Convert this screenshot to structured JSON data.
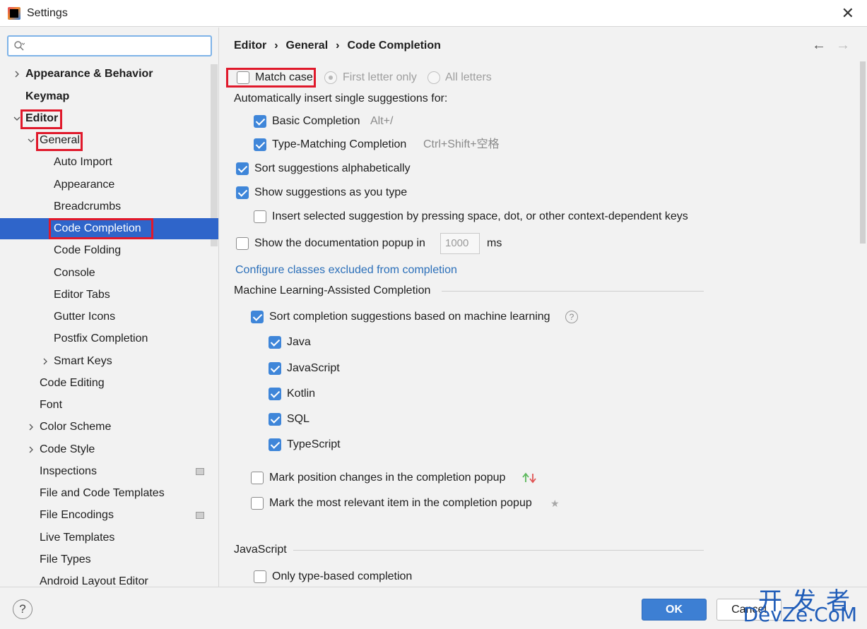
{
  "window": {
    "title": "Settings"
  },
  "sidebar": {
    "search_placeholder": "",
    "items": [
      {
        "label": "Appearance & Behavior"
      },
      {
        "label": "Keymap"
      },
      {
        "label": "Editor"
      },
      {
        "label": "General"
      },
      {
        "label": "Auto Import"
      },
      {
        "label": "Appearance"
      },
      {
        "label": "Breadcrumbs"
      },
      {
        "label": "Code Completion"
      },
      {
        "label": "Code Folding"
      },
      {
        "label": "Console"
      },
      {
        "label": "Editor Tabs"
      },
      {
        "label": "Gutter Icons"
      },
      {
        "label": "Postfix Completion"
      },
      {
        "label": "Smart Keys"
      },
      {
        "label": "Code Editing"
      },
      {
        "label": "Font"
      },
      {
        "label": "Color Scheme"
      },
      {
        "label": "Code Style"
      },
      {
        "label": "Inspections"
      },
      {
        "label": "File and Code Templates"
      },
      {
        "label": "File Encodings"
      },
      {
        "label": "Live Templates"
      },
      {
        "label": "File Types"
      },
      {
        "label": "Android Layout Editor"
      }
    ]
  },
  "breadcrumb": {
    "a": "Editor",
    "b": "General",
    "c": "Code Completion"
  },
  "content": {
    "match_case": "Match case:",
    "first_letter": "First letter only",
    "all_letters": "All letters",
    "auto_insert": "Automatically insert single suggestions for:",
    "basic": "Basic Completion",
    "basic_shortcut": "Alt+/",
    "type_matching": "Type-Matching Completion",
    "type_shortcut": "Ctrl+Shift+空格",
    "sort_alpha": "Sort suggestions alphabetically",
    "show_as_type": "Show suggestions as you type",
    "insert_selected": "Insert selected suggestion by pressing space, dot, or other context-dependent keys",
    "show_doc": "Show the documentation popup in",
    "doc_ms_value": "1000",
    "ms": "ms",
    "configure_link": "Configure classes excluded from completion",
    "ml_section": "Machine Learning-Assisted Completion",
    "ml_sort": "Sort completion suggestions based on machine learning",
    "ml_help": "?",
    "langs": [
      "Java",
      "JavaScript",
      "Kotlin",
      "SQL",
      "TypeScript"
    ],
    "mark_pos": "Mark position changes in the completion popup",
    "mark_relevant": "Mark the most relevant item in the completion popup",
    "star": "★",
    "js_section": "JavaScript",
    "only_type_based": "Only type-based completion"
  },
  "footer": {
    "help": "?",
    "ok": "OK",
    "cancel": "Cancel"
  },
  "watermark": {
    "top": "开发者",
    "bottom": "DevZe.CoM"
  }
}
